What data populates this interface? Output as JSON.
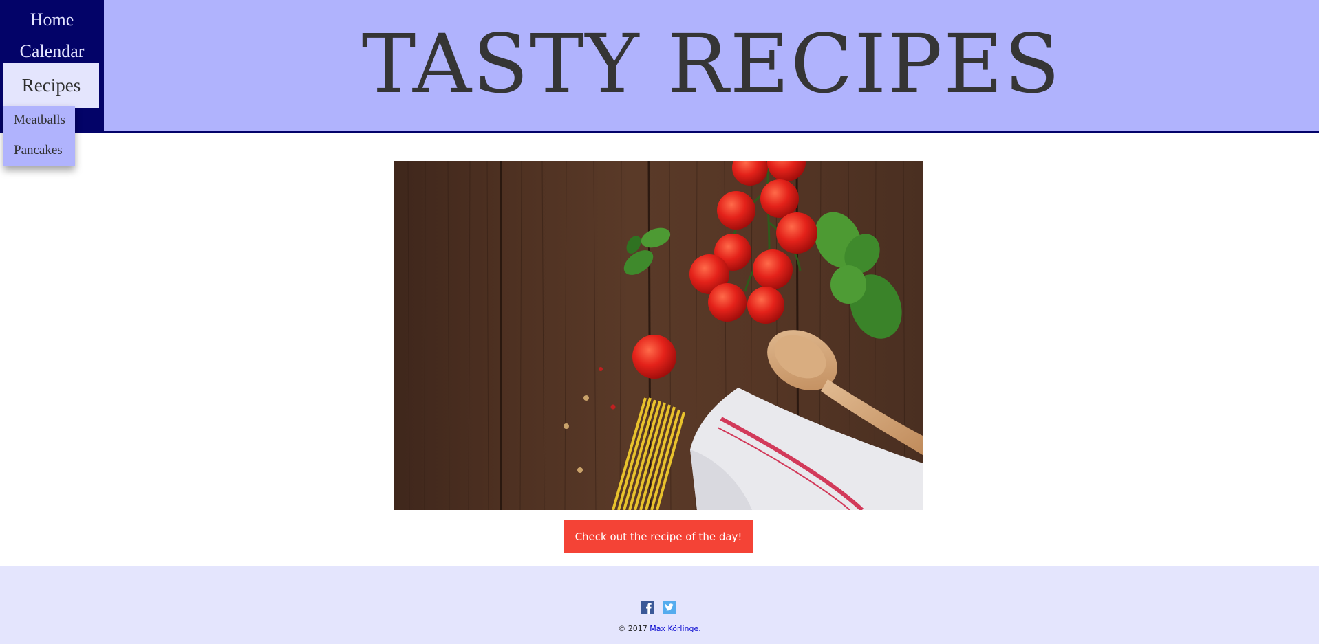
{
  "header": {
    "title": "TASTY RECIPES"
  },
  "nav": {
    "items": [
      {
        "label": "Home"
      },
      {
        "label": "Calendar"
      },
      {
        "label": "Recipes"
      }
    ],
    "recipes_dropdown": [
      {
        "label": "Meatballs"
      },
      {
        "label": "Pancakes"
      }
    ]
  },
  "main": {
    "cta_label": "Check out the recipe of the day!"
  },
  "footer": {
    "social": [
      "facebook-icon",
      "twitter-icon"
    ],
    "copyright_prefix": "© 2017 ",
    "author_link": "Max Körlinge."
  },
  "colors": {
    "header_bg": "#b0b3fd",
    "nav_bg": "#030368",
    "nav_active_bg": "#e4e5fd",
    "cta_bg": "#f44336",
    "footer_bg": "#e4e5fd"
  }
}
